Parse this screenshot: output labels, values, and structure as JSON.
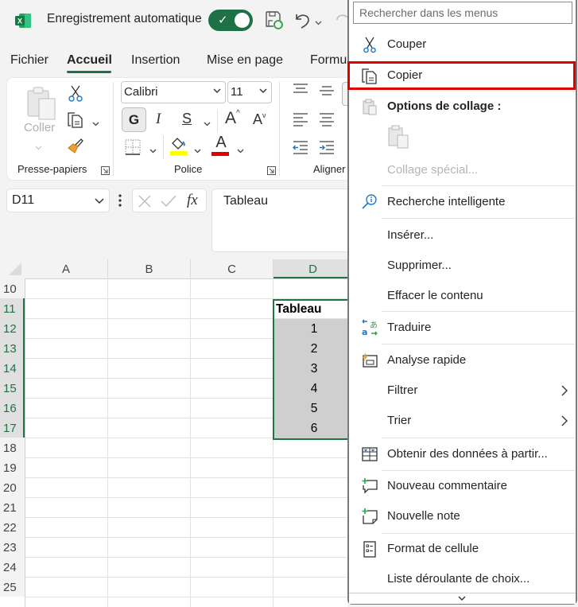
{
  "titlebar": {
    "app_icon": "excel-logo",
    "autosave_label": "Enregistrement automatique",
    "autosave_on": true
  },
  "tabs": [
    {
      "label": "Fichier",
      "active": false
    },
    {
      "label": "Accueil",
      "active": true
    },
    {
      "label": "Insertion",
      "active": false
    },
    {
      "label": "Mise en page",
      "active": false
    },
    {
      "label": "Formu",
      "active": false
    }
  ],
  "ribbon": {
    "clipboard": {
      "paste_label": "Coller",
      "group_label": "Presse-papiers"
    },
    "font": {
      "font_name": "Calibri",
      "font_size": "11",
      "bold_label": "G",
      "italic_label": "I",
      "underline_label": "S",
      "grow_label": "A",
      "shrink_label": "A",
      "font_color_label": "A",
      "highlight_color": "#ffff00",
      "font_color": "#e00000",
      "group_label": "Police"
    },
    "alignment": {
      "group_label": "Aligner"
    }
  },
  "formula_bar": {
    "name_box": "D11",
    "formula_value": "Tableau",
    "fx_label": "fx"
  },
  "sheet": {
    "columns": [
      "A",
      "B",
      "C",
      "D"
    ],
    "selected_column": "D",
    "rows": [
      "10",
      "11",
      "12",
      "13",
      "14",
      "15",
      "16",
      "17",
      "18",
      "19",
      "20",
      "21",
      "22",
      "23",
      "24",
      "25"
    ],
    "selected_rows": [
      "11",
      "12",
      "13",
      "14",
      "15",
      "16",
      "17"
    ],
    "cells": {
      "D11": "Tableau",
      "D12": "1",
      "D13": "2",
      "D14": "3",
      "D15": "4",
      "D16": "5",
      "D17": "6"
    }
  },
  "context_menu": {
    "search_placeholder": "Rechercher dans les menus",
    "highlighted_item": "Copier",
    "items": [
      {
        "label": "Couper",
        "icon": "scissors-icon"
      },
      {
        "label": "Copier",
        "icon": "copy-icon"
      },
      {
        "label": "Options de collage :",
        "icon": "paste-icon",
        "header": true
      },
      {
        "label": "",
        "icon": "paste-option-icon"
      },
      {
        "label": "Collage spécial...",
        "disabled": true
      },
      {
        "label": "Recherche intelligente",
        "icon": "smart-lookup-icon"
      },
      {
        "label": "Insérer..."
      },
      {
        "label": "Supprimer..."
      },
      {
        "label": "Effacer le contenu"
      },
      {
        "label": "Traduire",
        "icon": "translate-icon"
      },
      {
        "label": "Analyse rapide",
        "icon": "quick-analysis-icon"
      },
      {
        "label": "Filtrer",
        "submenu": true
      },
      {
        "label": "Trier",
        "submenu": true
      },
      {
        "label": "Obtenir des données à partir...",
        "icon": "table-icon"
      },
      {
        "label": "Nouveau commentaire",
        "icon": "new-comment-icon"
      },
      {
        "label": "Nouvelle note",
        "icon": "new-note-icon"
      },
      {
        "label": "Format de cellule",
        "icon": "format-cells-icon"
      },
      {
        "label": "Liste déroulante de choix..."
      }
    ]
  },
  "colors": {
    "accent_green": "#217346",
    "highlight_red": "#e00000"
  }
}
